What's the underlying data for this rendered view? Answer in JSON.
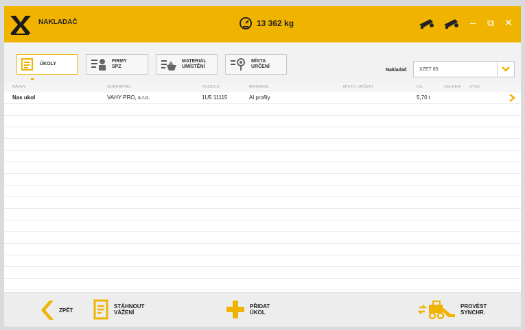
{
  "app": {
    "title": "NAKLADAČ",
    "weight": "13 362 kg"
  },
  "colors": {
    "accent": "#f0b400",
    "title_bg": "#f0b400"
  },
  "window_controls": {
    "minimize": "–",
    "restore": "⧉",
    "close": "✕"
  },
  "toolbar": {
    "buttons": [
      {
        "label": "ÚKOLY",
        "icon": "tasks-icon",
        "active": true
      },
      {
        "label": "FIRMY\nSPZ",
        "icon": "companies-icon",
        "active": false
      },
      {
        "label": "MATERIÁL\nUMÍSTĚNÍ",
        "icon": "material-icon",
        "active": false
      },
      {
        "label": "MÍSTA\nURČENÍ",
        "icon": "destination-icon",
        "active": false
      }
    ],
    "loader_label": "Nakladač",
    "loader_value": "XZET 85"
  },
  "table": {
    "columns": [
      "NÁZEV",
      "ODBĚRATEL",
      "VOZIDLO",
      "MATERIÁL",
      "MÍSTO URČENÍ",
      "CÍL",
      "CELKEM",
      "SYNC"
    ],
    "rows": [
      {
        "nazev": "Nas ukol",
        "odberatel": "VAHY PRO, s.r.o.",
        "vozidlo": "1U5 11115",
        "material": "Al profily",
        "misto": "",
        "cil": "5,70 t",
        "celkem": "",
        "sync": ""
      }
    ]
  },
  "footer": {
    "back": "ZPĚT",
    "download": "STÁHNOUT\nVÁŽENÍ",
    "add": "PŘIDAT\nÚKOL",
    "sync": "PROVÉST\nSYNCHR."
  }
}
